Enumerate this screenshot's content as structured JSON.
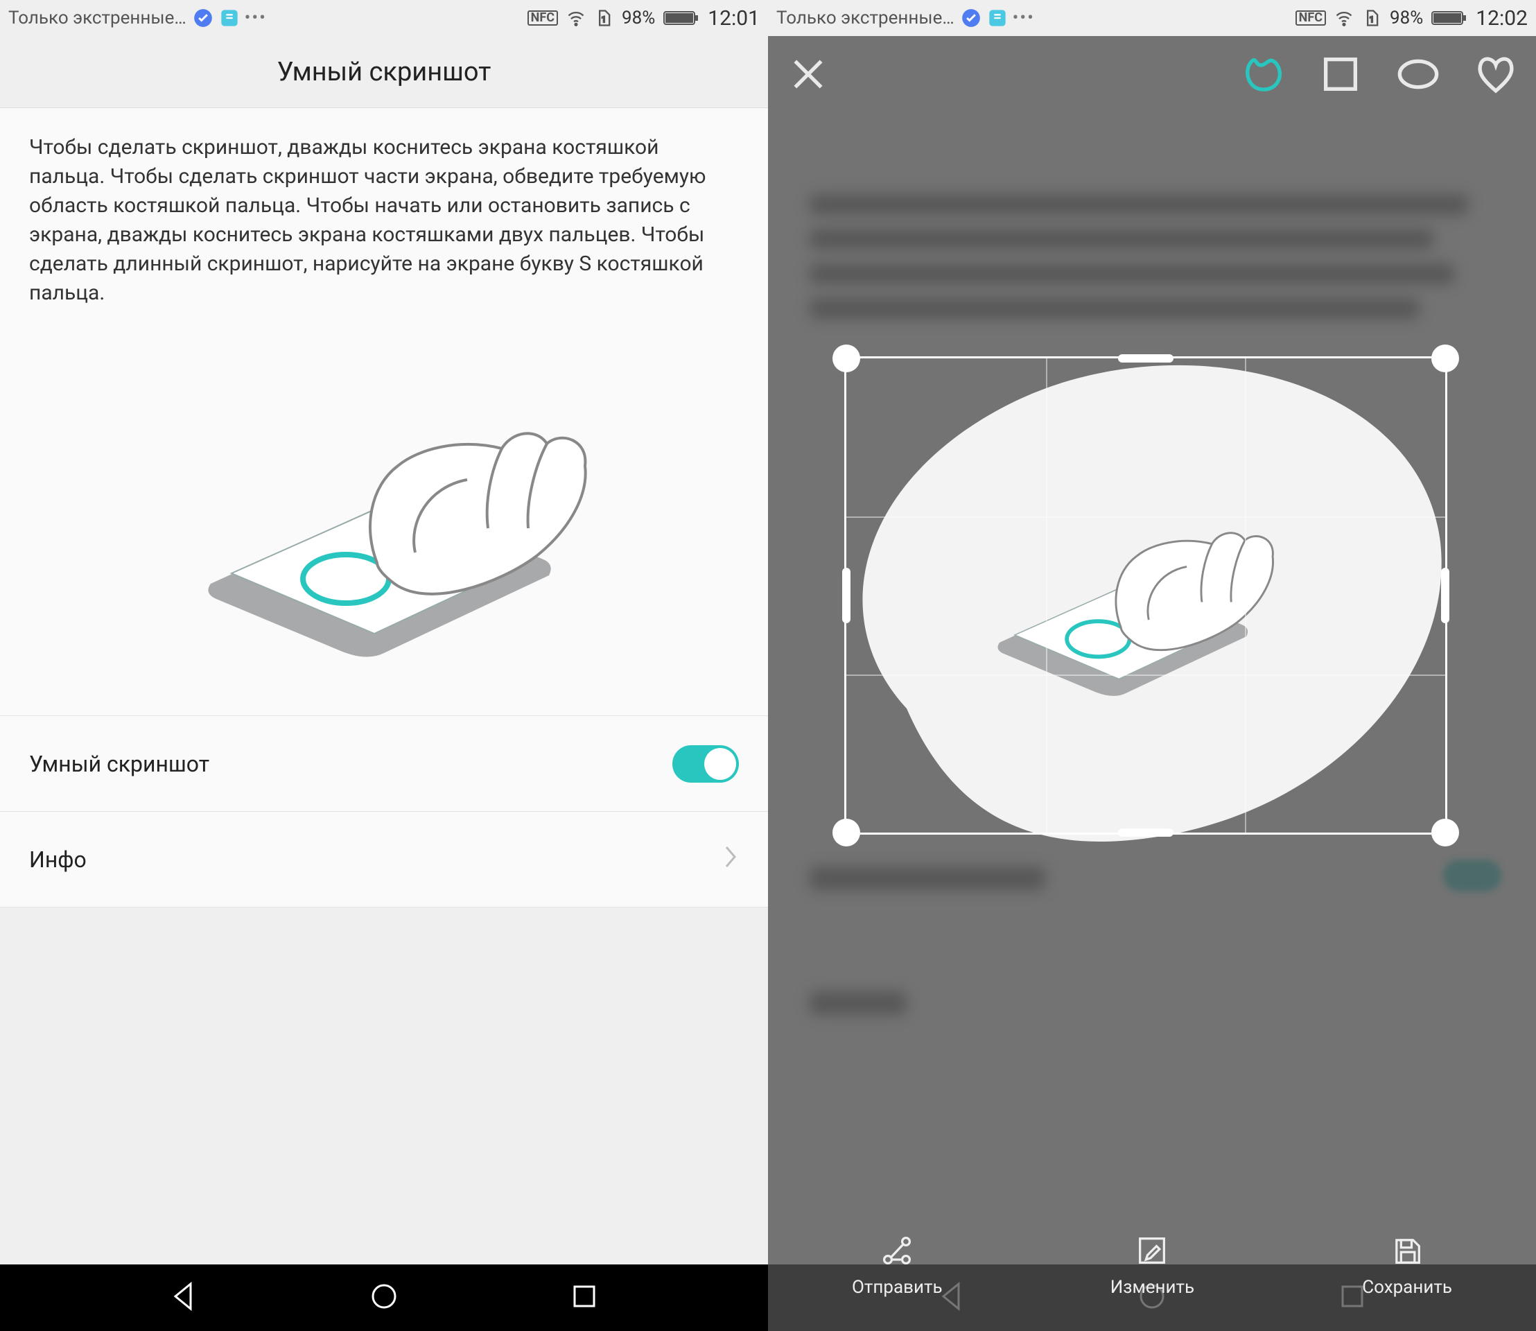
{
  "left": {
    "status": {
      "network_text": "Только экстренные…",
      "nfc": "NFC",
      "battery": "98%",
      "time": "12:01"
    },
    "title": "Умный скриншот",
    "description": "Чтобы сделать скриншот, дважды коснитесь экрана костяшкой пальца. Чтобы сделать скриншот части экрана, обведите требуемую область костяшкой пальца. Чтобы начать или остановить запись с экрана, дважды коснитесь экрана костяшками двух пальцев. Чтобы сделать длинный скриншот, нарисуйте на экране букву S костяшкой пальца.",
    "toggle_label": "Умный скриншот",
    "info_label": "Инфо"
  },
  "right": {
    "status": {
      "network_text": "Только экстренные…",
      "nfc": "NFC",
      "battery": "98%",
      "time": "12:02"
    },
    "tools": {
      "close": "close",
      "freeform": "freeform-shape",
      "square": "square-shape",
      "ellipse": "ellipse-shape",
      "heart": "heart-shape",
      "active": "freeform-shape"
    },
    "actions": {
      "share": "Отправить",
      "edit": "Изменить",
      "save": "Сохранить"
    }
  }
}
